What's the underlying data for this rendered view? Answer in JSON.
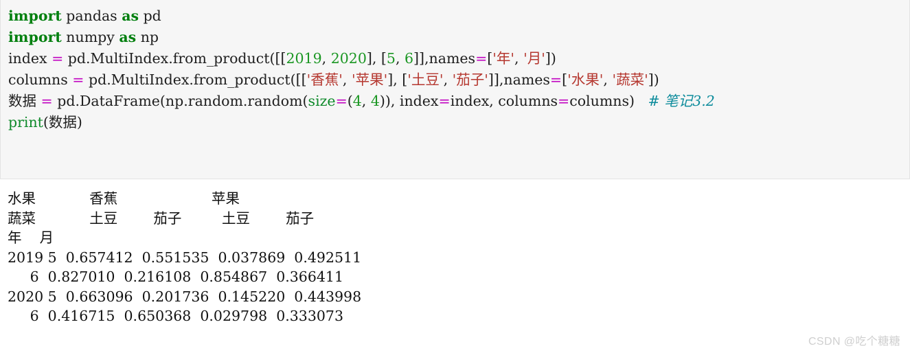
{
  "code_block": {
    "background": "#f6f6f6",
    "border_color": "#e3e3e3",
    "lines": [
      {
        "id": "line-1",
        "tokens": [
          {
            "t": "keyword",
            "v": "import"
          },
          {
            "t": "plain",
            "v": " pandas "
          },
          {
            "t": "keyword",
            "v": "as"
          },
          {
            "t": "plain",
            "v": " pd"
          }
        ]
      },
      {
        "id": "line-2",
        "tokens": [
          {
            "t": "keyword",
            "v": "import"
          },
          {
            "t": "plain",
            "v": " numpy "
          },
          {
            "t": "keyword",
            "v": "as"
          },
          {
            "t": "plain",
            "v": " np"
          }
        ]
      },
      {
        "id": "line-3",
        "tokens": [
          {
            "t": "plain",
            "v": "index "
          },
          {
            "t": "operator",
            "v": "="
          },
          {
            "t": "plain",
            "v": " pd.MultiIndex.from_product([["
          },
          {
            "t": "number",
            "v": "2019"
          },
          {
            "t": "plain",
            "v": ", "
          },
          {
            "t": "number",
            "v": "2020"
          },
          {
            "t": "plain",
            "v": "], ["
          },
          {
            "t": "number",
            "v": "5"
          },
          {
            "t": "plain",
            "v": ", "
          },
          {
            "t": "number",
            "v": "6"
          },
          {
            "t": "plain",
            "v": "]],names"
          },
          {
            "t": "operator",
            "v": "="
          },
          {
            "t": "plain",
            "v": "["
          },
          {
            "t": "string",
            "v": "'年'"
          },
          {
            "t": "plain",
            "v": ", "
          },
          {
            "t": "string",
            "v": "'月'"
          },
          {
            "t": "plain",
            "v": "])"
          }
        ]
      },
      {
        "id": "line-4",
        "tokens": [
          {
            "t": "plain",
            "v": "columns "
          },
          {
            "t": "operator",
            "v": "="
          },
          {
            "t": "plain",
            "v": " pd.MultiIndex.from_product([["
          },
          {
            "t": "string",
            "v": "'香蕉'"
          },
          {
            "t": "plain",
            "v": ", "
          },
          {
            "t": "string",
            "v": "'苹果'"
          },
          {
            "t": "plain",
            "v": "], ["
          },
          {
            "t": "string",
            "v": "'土豆'"
          },
          {
            "t": "plain",
            "v": ", "
          },
          {
            "t": "string",
            "v": "'茄子'"
          },
          {
            "t": "plain",
            "v": "]],names"
          },
          {
            "t": "operator",
            "v": "="
          },
          {
            "t": "plain",
            "v": "["
          },
          {
            "t": "string",
            "v": "'水果'"
          },
          {
            "t": "plain",
            "v": ", "
          },
          {
            "t": "string",
            "v": "'蔬菜'"
          },
          {
            "t": "plain",
            "v": "])"
          }
        ]
      },
      {
        "id": "line-5",
        "tokens": [
          {
            "t": "plain",
            "v": "数据 "
          },
          {
            "t": "operator",
            "v": "="
          },
          {
            "t": "plain",
            "v": " pd.DataFrame(np.random.random("
          },
          {
            "t": "builtin",
            "v": "size"
          },
          {
            "t": "operator",
            "v": "="
          },
          {
            "t": "plain",
            "v": "("
          },
          {
            "t": "number",
            "v": "4"
          },
          {
            "t": "plain",
            "v": ", "
          },
          {
            "t": "number",
            "v": "4"
          },
          {
            "t": "plain",
            "v": ")), index"
          },
          {
            "t": "operator",
            "v": "="
          },
          {
            "t": "plain",
            "v": "index, columns"
          },
          {
            "t": "operator",
            "v": "="
          },
          {
            "t": "plain",
            "v": "columns)   "
          },
          {
            "t": "comment",
            "v": "# 笔记3.2"
          }
        ]
      },
      {
        "id": "line-6",
        "tokens": [
          {
            "t": "builtin",
            "v": "print"
          },
          {
            "t": "plain",
            "v": "(数据)"
          }
        ]
      }
    ]
  },
  "output": {
    "raw_lines": [
      "水果            香蕉                     苹果",
      "蔬菜            土豆        茄子         土豆        茄子",
      "年    月",
      "2019 5  0.657412  0.551535  0.037869  0.492511",
      "     6  0.827010  0.216108  0.854867  0.366411",
      "2020 5  0.663096  0.201736  0.145220  0.443998",
      "     6  0.416715  0.650368  0.029798  0.333073"
    ],
    "dataframe": {
      "column_level_names": [
        "水果",
        "蔬菜"
      ],
      "index_level_names": [
        "年",
        "月"
      ],
      "column_level_0": [
        "香蕉",
        "香蕉",
        "苹果",
        "苹果"
      ],
      "column_level_1": [
        "土豆",
        "茄子",
        "土豆",
        "茄子"
      ],
      "rows": [
        {
          "年": "2019",
          "月": "5",
          "values": [
            "0.657412",
            "0.551535",
            "0.037869",
            "0.492511"
          ]
        },
        {
          "年": "",
          "月": "6",
          "values": [
            "0.827010",
            "0.216108",
            "0.854867",
            "0.366411"
          ]
        },
        {
          "年": "2020",
          "月": "5",
          "values": [
            "0.663096",
            "0.201736",
            "0.145220",
            "0.443998"
          ]
        },
        {
          "年": "",
          "月": "6",
          "values": [
            "0.416715",
            "0.650368",
            "0.029798",
            "0.333073"
          ]
        }
      ]
    }
  },
  "watermark": {
    "text": "CSDN @吃个糖糖",
    "color": "#cfcfcf"
  }
}
